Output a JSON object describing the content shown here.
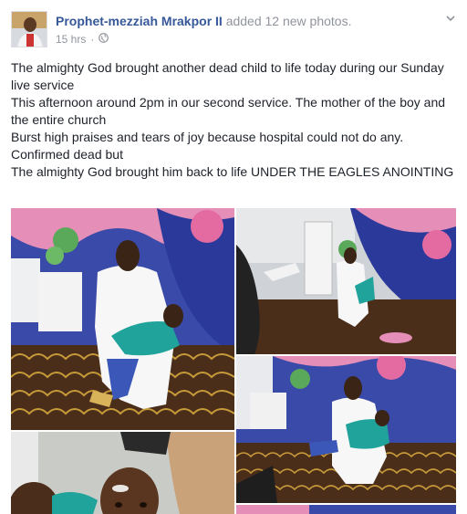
{
  "post": {
    "author": "Prophet-mezziah Mrakpor II",
    "action": "added 12 new photos.",
    "timestamp": "15 hrs",
    "privacy_icon": "globe-icon",
    "menu_icon": "chevron-down-icon",
    "text_lines": [
      "The almighty God brought another dead child to life today during our Sunday live service",
      "This afternoon around 2pm in our second service. The mother of the boy and the entire church",
      "Burst high praises and tears of joy because hospital could not do any. Confirmed dead but",
      "The almighty God brought him back to life UNDER THE EAGLES ANOINTING"
    ]
  },
  "colors": {
    "link": "#365899",
    "meta": "#90949c",
    "text": "#1d2129"
  }
}
